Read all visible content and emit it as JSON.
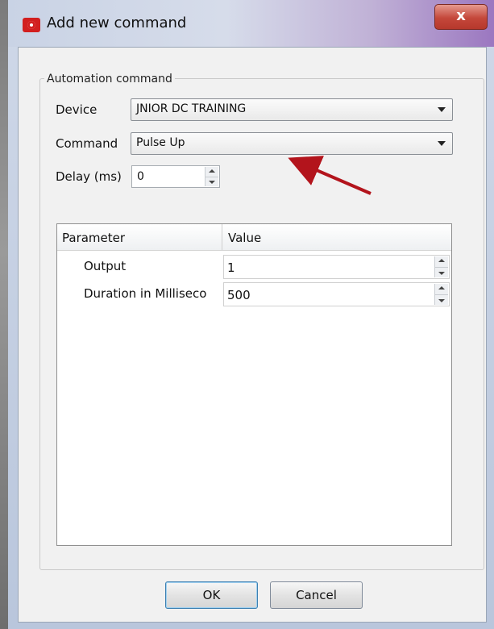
{
  "window": {
    "title": "Add new command",
    "close_glyph": "x"
  },
  "group": {
    "legend": "Automation command"
  },
  "fields": {
    "device_label": "Device",
    "device_value": "JNIOR DC TRAINING",
    "command_label": "Command",
    "command_value": "Pulse Up",
    "delay_label": "Delay (ms)",
    "delay_value": "0"
  },
  "table": {
    "headers": [
      "Parameter",
      "Value"
    ],
    "rows": [
      {
        "name": "Output",
        "value": "1"
      },
      {
        "name": "Duration in Milliseco",
        "value": "500"
      }
    ]
  },
  "buttons": {
    "ok": "OK",
    "cancel": "Cancel"
  },
  "annotation": {
    "arrow_color": "#b3141c"
  }
}
